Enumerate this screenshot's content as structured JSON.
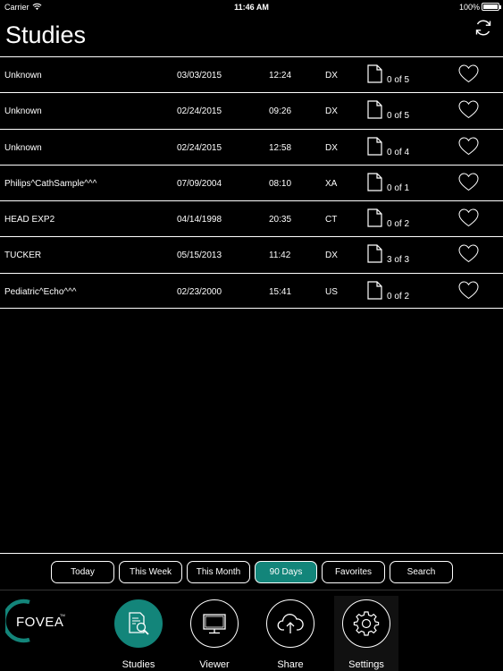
{
  "status_bar": {
    "carrier": "Carrier",
    "time": "11:46 AM",
    "battery": "100%"
  },
  "header": {
    "title": "Studies"
  },
  "studies": [
    {
      "name": "Unknown",
      "date": "03/03/2015",
      "time": "12:24",
      "modality": "DX",
      "count": "0 of 5"
    },
    {
      "name": "Unknown",
      "date": "02/24/2015",
      "time": "09:26",
      "modality": "DX",
      "count": "0 of 5"
    },
    {
      "name": "Unknown",
      "date": "02/24/2015",
      "time": "12:58",
      "modality": "DX",
      "count": "0 of 4"
    },
    {
      "name": "Philips^CathSample^^^",
      "date": "07/09/2004",
      "time": "08:10",
      "modality": "XA",
      "count": "0 of 1"
    },
    {
      "name": "HEAD EXP2",
      "date": "04/14/1998",
      "time": "20:35",
      "modality": "CT",
      "count": "0 of 2"
    },
    {
      "name": "TUCKER",
      "date": "05/15/2013",
      "time": "11:42",
      "modality": "DX",
      "count": "3 of 3"
    },
    {
      "name": "Pediatric^Echo^^^",
      "date": "02/23/2000",
      "time": "15:41",
      "modality": "US",
      "count": "0 of 2"
    }
  ],
  "filters": {
    "today": "Today",
    "this_week": "This Week",
    "this_month": "This Month",
    "days_90": "90 Days",
    "favorites": "Favorites",
    "search": "Search",
    "selected": "90 Days"
  },
  "tabs": {
    "studies": "Studies",
    "viewer": "Viewer",
    "share": "Share",
    "settings": "Settings"
  },
  "logo": {
    "text": "FOVEA",
    "tm": "TM"
  },
  "colors": {
    "accent": "#13857a",
    "background": "#000000",
    "foreground": "#ffffff"
  }
}
